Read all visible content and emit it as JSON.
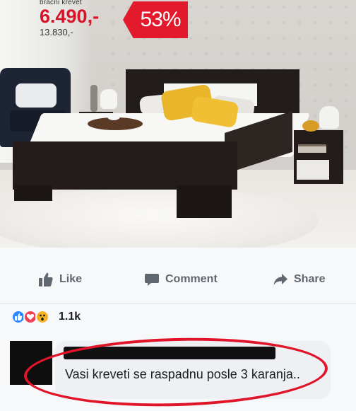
{
  "ad": {
    "product_label": "bracni krevet",
    "price": "6.490,-",
    "old_price": "13.830,-",
    "discount": "53%",
    "brand_color": "#e31a2c"
  },
  "actions": {
    "like": "Like",
    "comment": "Comment",
    "share": "Share"
  },
  "reactions": {
    "icons": [
      "like-icon",
      "love-icon",
      "wow-icon"
    ],
    "count": "1.1k"
  },
  "comment": {
    "text": "Vasi kreveti se raspadnu posle 3 karanja.."
  },
  "colors": {
    "fb_gray": "#606770",
    "highlight_red": "#e0152a"
  }
}
